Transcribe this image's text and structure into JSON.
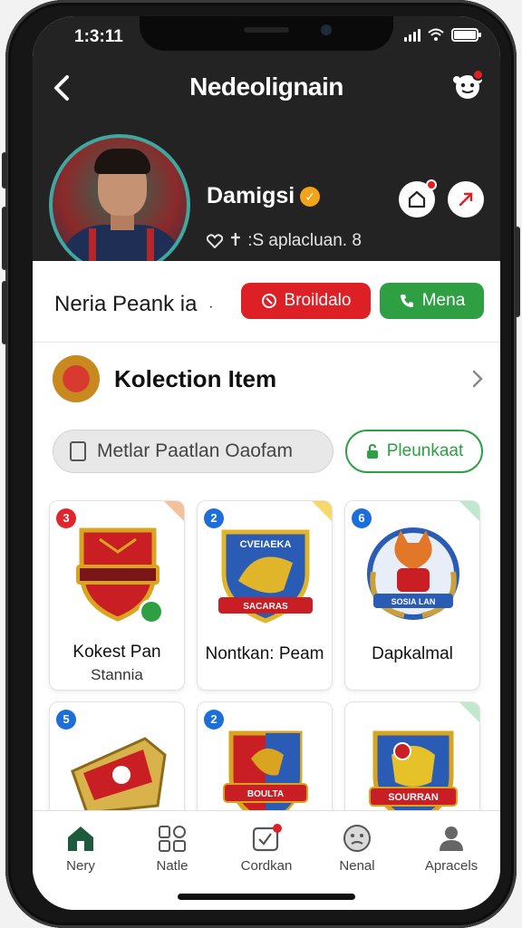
{
  "status_bar": {
    "time": "1:3:11"
  },
  "header": {
    "title": "Nedeolignain"
  },
  "profile": {
    "name": "Damigsi",
    "meta": "✝ :S aplacluan. 8"
  },
  "action_row": {
    "label": "Neria Peank ia",
    "dot": "·",
    "primary_label": "Broildalo",
    "secondary_label": "Mena"
  },
  "collection": {
    "title": "Kolection Item",
    "search_placeholder": "Metlar Paatlan Oaofam",
    "filter_label": "Pleunkaat"
  },
  "cards": [
    {
      "badge": "3",
      "badge_color": "#e0262c",
      "name": "Kokest Pan",
      "sub": "Stannia",
      "corner": "#f4c29a"
    },
    {
      "badge": "2",
      "badge_color": "#1c6ed8",
      "name": "Nontkan: Peam",
      "sub": "",
      "corner": "#f6d96a",
      "crest_text": "CVEIAEKA",
      "crest_text2": "SACARAS"
    },
    {
      "badge": "6",
      "badge_color": "#1c6ed8",
      "name": "Dapkalmal",
      "sub": "",
      "corner": "#bfe8cc",
      "crest_text": "SOSIA LAN"
    },
    {
      "badge": "5",
      "badge_color": "#1c6ed8",
      "name": "",
      "sub": "",
      "corner": "#ffffff"
    },
    {
      "badge": "2",
      "badge_color": "#1c6ed8",
      "name": "",
      "sub": "",
      "corner": "#ffffff",
      "crest_text": "BOULTA"
    },
    {
      "badge": "",
      "badge_color": "#1c6ed8",
      "name": "",
      "sub": "",
      "corner": "#bfe8cc",
      "crest_text": "SOURRAN"
    }
  ],
  "bottom_nav": [
    {
      "label": "Nery",
      "icon": "home-icon"
    },
    {
      "label": "Natle",
      "icon": "grid-icon"
    },
    {
      "label": "Cordkan",
      "icon": "checkbox-icon"
    },
    {
      "label": "Nenal",
      "icon": "face-icon"
    },
    {
      "label": "Apracels",
      "icon": "person-icon"
    }
  ],
  "colors": {
    "header_bg": "#232323",
    "red": "#dd1f26",
    "green": "#2ea043"
  }
}
